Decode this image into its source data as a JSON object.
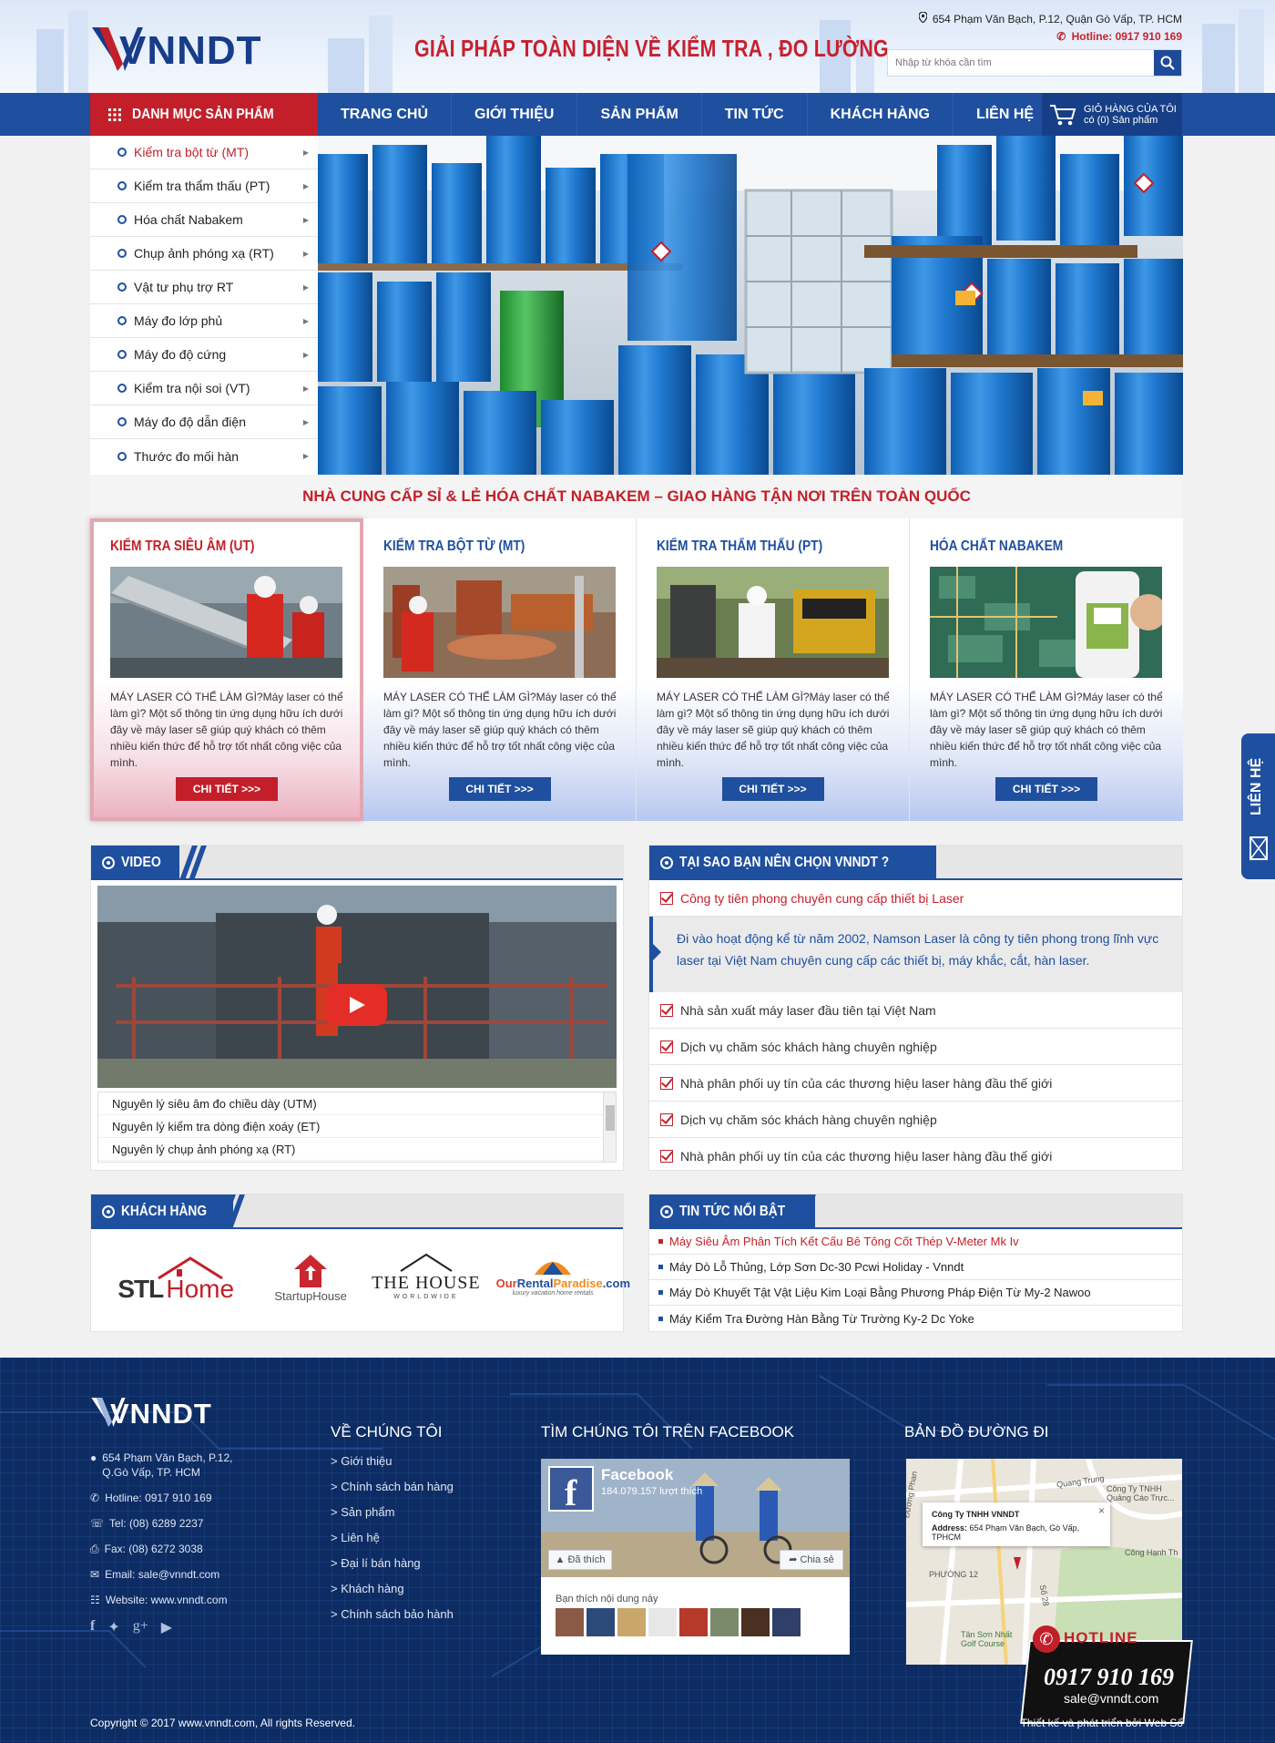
{
  "header": {
    "logo_text": "VNNDT",
    "slogan": "GIẢI PHÁP TOÀN DIỆN VỀ KIỂM TRA , ĐO LƯỜNG",
    "address": "654 Phạm Văn Bạch, P.12, Quận Gò Vấp, TP. HCM",
    "hotline": "Hotline: 0917 910 169",
    "search_placeholder": "Nhập từ khóa cần tìm"
  },
  "nav": {
    "category_label": "DANH MỤC SẢN PHẨM",
    "items": [
      "TRANG CHỦ",
      "GIỚI THIỆU",
      "SẢN PHẨM",
      "TIN TỨC",
      "KHÁCH HÀNG",
      "LIÊN HỆ"
    ],
    "cart_line1": "GIỎ HÀNG CỦA TÔI",
    "cart_line2": "có (0) Sản phẩm"
  },
  "sidebar": {
    "items": [
      "Kiểm tra bột từ (MT)",
      "Kiểm tra thẩm thấu (PT)",
      "Hóa chất Nabakem",
      "Chụp ảnh phóng xạ (RT)",
      "Vật tư phụ trợ RT",
      "Máy đo lớp phủ",
      "Máy đo độ cứng",
      "Kiểm tra nội soi (VT)",
      "Máy đo độ dẫn điện",
      "Thước đo mối hàn"
    ]
  },
  "tagline": "NHÀ CUNG CẤP SỈ & LẺ HÓA CHẤT NABAKEM – GIAO HÀNG TẬN NƠI TRÊN TOÀN QUỐC",
  "services": [
    {
      "title": "KIỂM TRA SIÊU ÂM (UT)",
      "text": "MÁY LASER CÓ THỂ LÀM GÌ?Máy laser có thể làm gì? Một số thông tin ứng dụng hữu ích dưới đây về máy laser sẽ giúp quý khách có thêm nhiều kiến thức để hỗ trợ tốt nhất công việc của mình.",
      "button": "CHI TIẾT >>>"
    },
    {
      "title": "KIỂM TRA BỘT TỪ (MT)",
      "text": "MÁY LASER CÓ THỂ LÀM GÌ?Máy laser có thể làm gì? Một số thông tin ứng dụng hữu ích dưới đây về máy laser sẽ giúp quý khách có thêm nhiều kiến thức để hỗ trợ tốt nhất công việc của mình.",
      "button": "CHI TIẾT >>>"
    },
    {
      "title": "KIỂM TRA THẨM THẤU (PT)",
      "text": "MÁY LASER CÓ THỂ LÀM GÌ?Máy laser có thể làm gì? Một số thông tin ứng dụng hữu ích dưới đây về máy laser sẽ giúp quý khách có thêm nhiều kiến thức để hỗ trợ tốt nhất công việc của mình.",
      "button": "CHI TIẾT >>>"
    },
    {
      "title": "HÓA CHẤT NABAKEM",
      "text": "MÁY LASER CÓ THỂ LÀM GÌ?Máy laser có thể làm gì? Một số thông tin ứng dụng hữu ích dưới đây về máy laser sẽ giúp quý khách có thêm nhiều kiến thức để hỗ trợ tốt nhất công việc của mình.",
      "button": "CHI TIẾT >>>"
    }
  ],
  "video": {
    "heading": "VIDEO",
    "list": [
      "Nguyên lý siêu âm đo chiều dày (UTM)",
      "Nguyên lý kiểm tra dòng điện xoáy (ET)",
      "Nguyên lý chụp ảnh phóng xạ (RT)"
    ]
  },
  "why": {
    "heading": "TẠI SAO BẠN NÊN CHỌN VNNDT ?",
    "highlight": "Công ty tiên phong chuyên cung cấp thiết bị Laser",
    "description": "Đi vào hoạt động kể từ năm 2002, Namson Laser là công ty tiên phong trong lĩnh vực laser tại Việt Nam chuyên cung cấp các thiết bị, máy khắc, cắt, hàn laser.",
    "items": [
      "Nhà sản xuất máy laser đầu tiên tại Việt Nam",
      "Dịch vụ chăm sóc khách hàng chuyên nghiệp",
      "Nhà phân phối uy tín của các thương hiệu laser hàng đầu thế giới",
      "Dịch vụ chăm sóc khách hàng chuyên nghiệp",
      "Nhà phân phối uy tín của các thương hiệu laser hàng đầu thế giới"
    ]
  },
  "customers": {
    "heading": "KHÁCH HÀNG",
    "logos": {
      "stl_a": "STL",
      "stl_b": "Home",
      "startup": "StartupHouse",
      "house_a": "THE HOUSE",
      "house_b": "WORLDWIDE",
      "orp_a": "Our",
      "orp_b": "Rental",
      "orp_c": "Paradise",
      "orp_d": ".com",
      "orp_sub": "luxury vacation home rentals"
    }
  },
  "news": {
    "heading": "TIN TỨC NỔI BẬT",
    "items": [
      "Máy Siêu Âm Phân Tích Kết Cấu Bê Tông Cốt Thép V-Meter Mk Iv",
      "Máy Dò Lỗ Thủng, Lớp Sơn Dc-30 Pcwi Holiday - Vnndt",
      "Máy Dò Khuyết Tật Vật Liệu Kim Loại Bằng Phương Pháp Điện Từ My-2 Nawoo",
      "Máy Kiểm Tra Đường Hàn Bằng Từ Trường Ky-2 Dc Yoke"
    ]
  },
  "contact_tab": "LIÊN HỆ",
  "footer": {
    "logo_text": "VNNDT",
    "address_1": "654 Phạm Văn Bạch, P.12,",
    "address_2": "Q.Gò Vấp, TP. HCM",
    "hotline": "Hotline: 0917 910 169",
    "tel": "Tel: (08) 6289 2237",
    "fax": "Fax: (08) 6272 3038",
    "email": "Email: sale@vnndt.com",
    "website": "Website: www.vnndt.com",
    "about_title": "VỀ CHÚNG TÔI",
    "about_links": [
      "> Giới thiệu",
      "> Chính sách bán hàng",
      "> Sản phẩm",
      "> Liên hệ",
      "> Đại lí bán hàng",
      "> Khách hàng",
      "> Chính sách bảo hành"
    ],
    "fb_title": "TÌM CHÚNG TÔI TRÊN FACEBOOK",
    "fb_page": "Facebook",
    "fb_likes": "184.079.157 lượt thích",
    "fb_like_btn": "Đã thích",
    "fb_share_btn": "Chia sẻ",
    "fb_friends": "Bạn thích nội dung này",
    "map_title": "BẢN ĐỒ ĐƯỜNG ĐI",
    "map_company": "Công Ty TNHH VNNDT",
    "map_address_label": "Address:",
    "map_address": "654 Phạm Văn Bạch, Gò Vấp, TPHCM",
    "map_labels": [
      "Công Ty TNHH Quảng Cáo Trực...",
      "Công Hạnh Th",
      "PHƯỜNG 12",
      "Tân Sơn Nhất Golf Course",
      "Quang Trung",
      "Số 28",
      "Đường Phan"
    ],
    "hotline_label": "HOTLINE",
    "hotline_number": "0917 910 169",
    "hotline_email": "sale@vnndt.com",
    "copyright": "Copyright © 2017 www.vnndt.com, All rights Reserved.",
    "credit": "Thiết kế và phát triển bởi Web Số"
  },
  "colors": {
    "primary": "#1f4f9f",
    "accent": "#c31f2a",
    "footer": "#0d2c63"
  }
}
